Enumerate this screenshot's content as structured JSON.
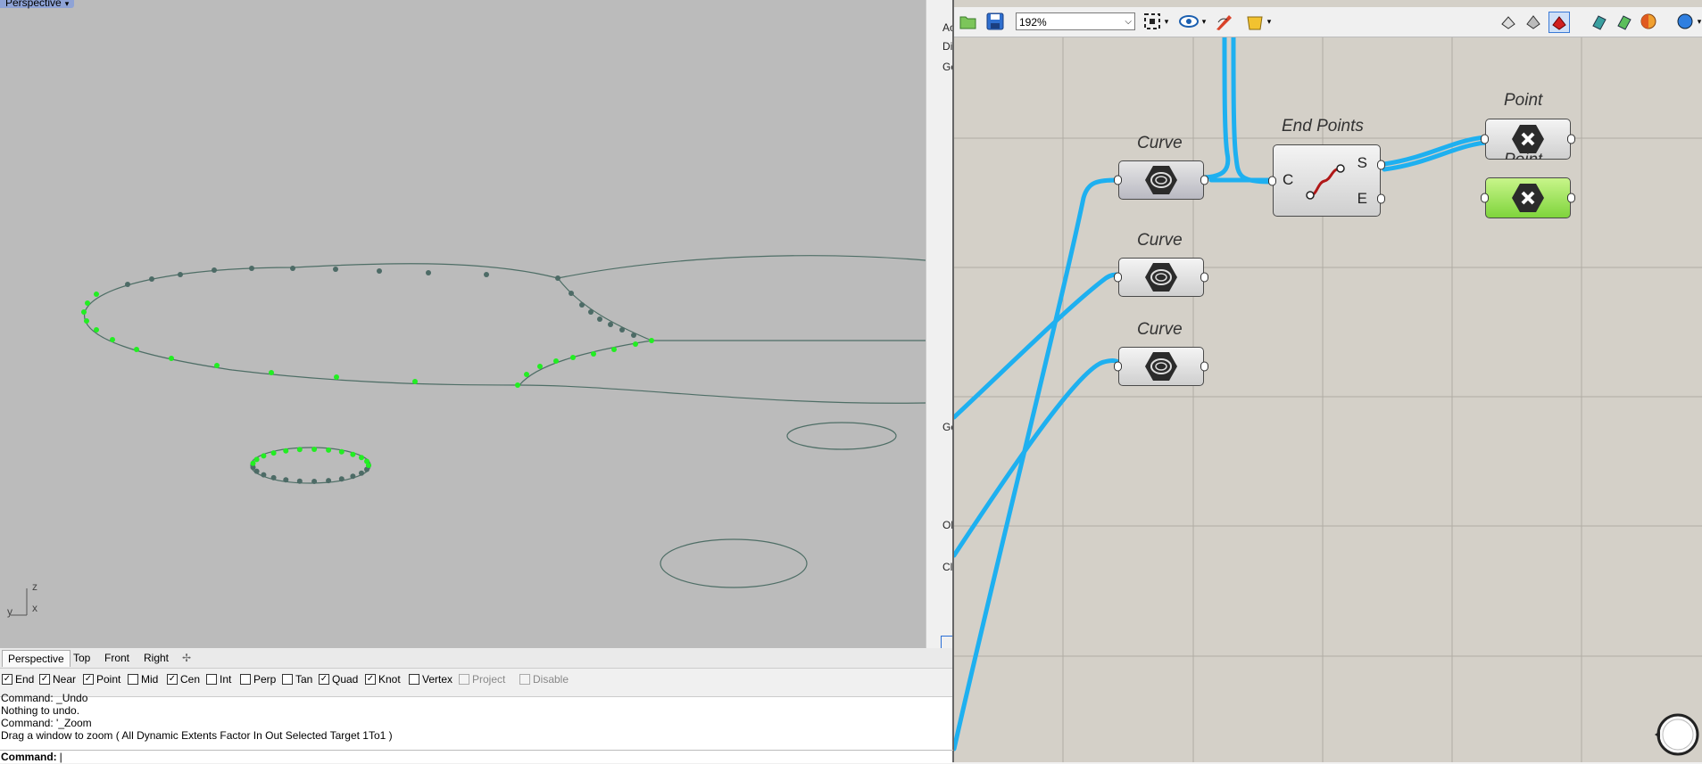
{
  "viewport": {
    "name": "Perspective",
    "axis_labels": {
      "z": "z",
      "x": "x",
      "y": "y"
    }
  },
  "rhino_side_labels": [
    "Ac",
    "Di",
    "Ge",
    "Ge",
    "Ol",
    "Cl"
  ],
  "view_tabs": [
    "Perspective",
    "Top",
    "Front",
    "Right"
  ],
  "osnaps": [
    {
      "label": "End",
      "checked": true
    },
    {
      "label": "Near",
      "checked": true
    },
    {
      "label": "Point",
      "checked": true
    },
    {
      "label": "Mid",
      "checked": false
    },
    {
      "label": "Cen",
      "checked": true
    },
    {
      "label": "Int",
      "checked": false
    },
    {
      "label": "Perp",
      "checked": false
    },
    {
      "label": "Tan",
      "checked": false
    },
    {
      "label": "Quad",
      "checked": true
    },
    {
      "label": "Knot",
      "checked": true
    },
    {
      "label": "Vertex",
      "checked": false
    },
    {
      "label": "Project",
      "checked": false,
      "disabled": true
    },
    {
      "label": "Disable",
      "checked": false,
      "disabled": true
    }
  ],
  "command_history": [
    "Command: _Undo",
    "Nothing to undo.",
    "Command: '_Zoom",
    "Drag a window to zoom ( All  Dynamic  Extents  Factor  In  Out  Selected  Target  1To1 )"
  ],
  "command_prompt": "Command:",
  "grasshopper": {
    "zoom": "192%",
    "components": {
      "curve1": "Curve",
      "curve2": "Curve",
      "curve3": "Curve",
      "endpoints": "End Points",
      "endpoints_in": "C",
      "endpoints_out_s": "S",
      "endpoints_out_e": "E",
      "point1": "Point",
      "point2": "Point"
    }
  },
  "colors": {
    "wire": "#1eb0f0",
    "selected_green": "#7fd43c",
    "curve_line": "#4e6e66",
    "point_highlight": "#22ee22",
    "point_dark": "#4d6b66"
  }
}
